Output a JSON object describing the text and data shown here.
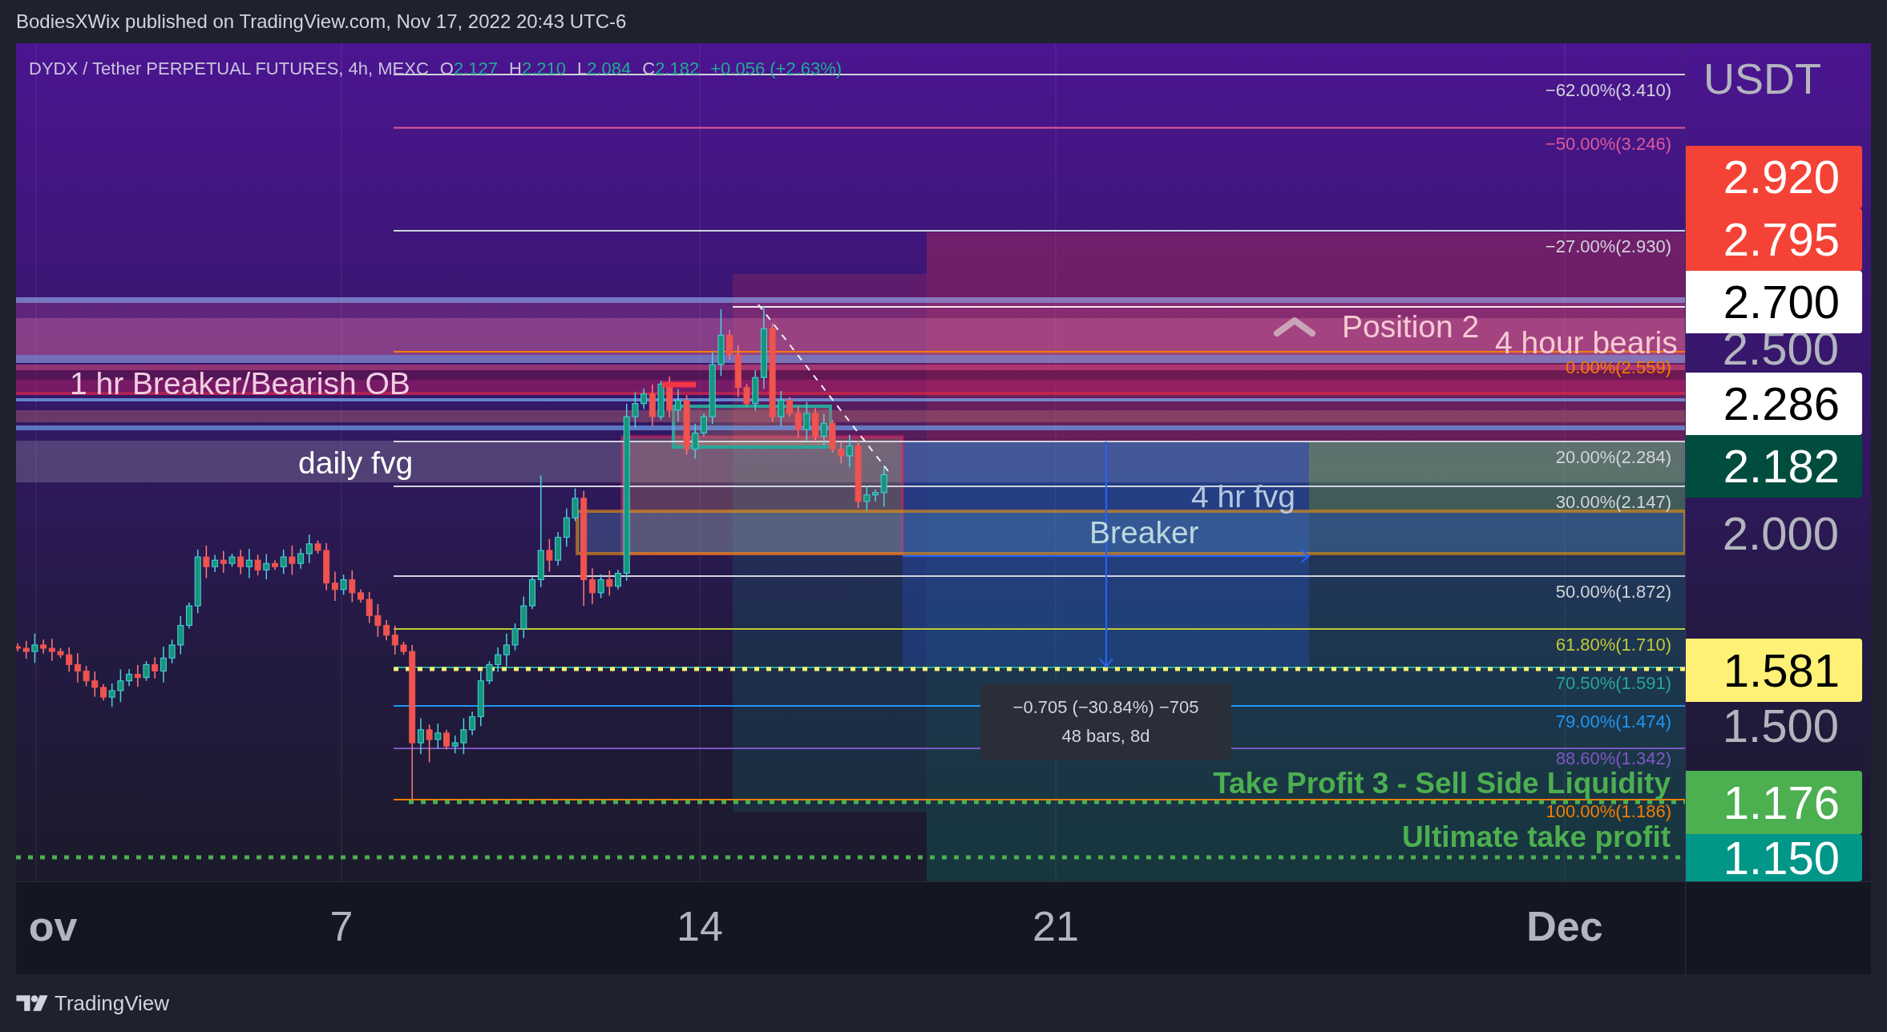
{
  "header": {
    "published": "BodiesXWix published on TradingView.com, Nov 17, 2022 20:43 UTC-6"
  },
  "chart": {
    "legend": {
      "symbol": "DYDX / Tether PERPETUAL FUTURES, 4h, MEXC",
      "ohlc": [
        {
          "label": "O",
          "value": "2.127"
        },
        {
          "label": "H",
          "value": "2.210"
        },
        {
          "label": "L",
          "value": "2.084"
        },
        {
          "label": "C",
          "value": "2.182"
        }
      ],
      "change": "+0.056 (+2.63%)"
    },
    "fib_levels": [
      {
        "label": "−62.00%(3.410)",
        "color": "#d1d4dc"
      },
      {
        "label": "−50.00%(3.246)",
        "color": "#e05a9c"
      },
      {
        "label": "−27.00%(2.930)",
        "color": "#d1d4dc"
      },
      {
        "label": "0.00%(2.559)",
        "color": "#f57c00"
      },
      {
        "label": "20.00%(2.284)",
        "color": "#d1d4dc"
      },
      {
        "label": "30.00%(2.147)",
        "color": "#d1d4dc"
      },
      {
        "label": "50.00%(1.872)",
        "color": "#d1d4dc"
      },
      {
        "label": "61.80%(1.710)",
        "color": "#c0ca33"
      },
      {
        "label": "70.50%(1.591)",
        "color": "#26a69a"
      },
      {
        "label": "79.00%(1.474)",
        "color": "#2196f3"
      },
      {
        "label": "88.60%(1.342)",
        "color": "#7e57c2"
      },
      {
        "label": "100.00%(1.186)",
        "color": "#f57c00"
      }
    ],
    "zone_labels": [
      {
        "text": "1 hr Breaker/Bearish OB",
        "kind": "zone"
      },
      {
        "text": "daily fvg",
        "kind": "zone"
      },
      {
        "text": "Position 2",
        "kind": "position"
      },
      {
        "text": "4 hour bearis",
        "kind": "zone"
      },
      {
        "text": "4 hr fvg",
        "kind": "zone"
      },
      {
        "text": "Breaker",
        "kind": "zone"
      },
      {
        "text": "Take Profit 3 - Sell Side Liquidity",
        "kind": "target"
      },
      {
        "text": "Ultimate take profit",
        "kind": "target"
      }
    ],
    "measure": {
      "change": "−0.705 (−30.84%) −705",
      "span": "48 bars, 8d"
    },
    "price_axis": {
      "unit": "USDT",
      "ticks": [
        "2.500",
        "2.000",
        "1.500"
      ],
      "badges": [
        {
          "value": "2.920",
          "color": "#f44336"
        },
        {
          "value": "2.795",
          "color": "#f44336"
        },
        {
          "value": "2.700",
          "color": "#ffffff"
        },
        {
          "value": "2.286",
          "color": "#ffffff"
        },
        {
          "value": "2.182",
          "color": "#004d40"
        },
        {
          "value": "1.581",
          "color": "#fff176"
        },
        {
          "value": "1.176",
          "color": "#4caf50"
        },
        {
          "value": "1.150",
          "color": "#009688"
        }
      ]
    },
    "time_axis": [
      {
        "label": "ov",
        "kind": "month"
      },
      {
        "label": "7",
        "kind": "day"
      },
      {
        "label": "14",
        "kind": "day"
      },
      {
        "label": "21",
        "kind": "day"
      },
      {
        "label": "Dec",
        "kind": "month"
      }
    ]
  },
  "footer": {
    "brand": "TradingView"
  }
}
